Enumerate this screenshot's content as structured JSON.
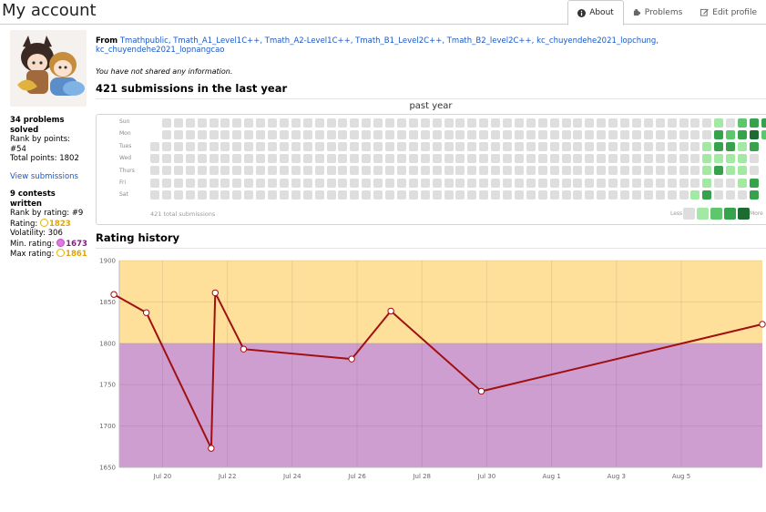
{
  "page": {
    "title": "My account"
  },
  "tabs": [
    {
      "label": "About",
      "icon": "info-icon",
      "active": true
    },
    {
      "label": "Problems",
      "icon": "puzzle-icon",
      "active": false
    },
    {
      "label": "Edit profile",
      "icon": "edit-icon",
      "active": false
    }
  ],
  "sidebar": {
    "problems_solved": "34 problems solved",
    "rank_by_points": "Rank by points: #54",
    "total_points": "Total points: 1802",
    "view_submissions": "View submissions",
    "contests_written": "9 contests written",
    "rank_by_rating": "Rank by rating: #9",
    "rating_label": "Rating:",
    "rating_value": "1823",
    "volatility": "Volatility: 306",
    "min_rating_label": "Min. rating:",
    "min_rating_value": "1673",
    "max_rating_label": "Max rating:",
    "max_rating_value": "1861",
    "colors": {
      "gold": "#e3a400",
      "purple": "#7c1f7c"
    }
  },
  "profile": {
    "from_label": "From",
    "organizations": "Tmathpublic, Tmath_A1_Level1C++, Tmath_A2-Level1C++, Tmath_B1_Level2C++, Tmath_B2_level2C++, kc_chuyendehe2021_lopchung, kc_chuyendehe2021_lopnangcao",
    "info_note": "You have not shared any information."
  },
  "submissions": {
    "heading": "421 submissions in the last year",
    "heatmap_title": "past year",
    "days": [
      "Sun",
      "Mon",
      "Tues",
      "Wed",
      "Thurs",
      "Fri",
      "Sat"
    ],
    "total_label": "421 total submissions",
    "less_label": "Less",
    "more_label": "More",
    "colors": [
      "#dedede",
      "#a3e8a3",
      "#5ec76e",
      "#37a24c",
      "#1d6b31"
    ],
    "recent_levels": [
      [
        0,
        0,
        0,
        0,
        0,
        0,
        0
      ],
      [
        0,
        0,
        0,
        0,
        0,
        0,
        1
      ],
      [
        0,
        0,
        1,
        1,
        1,
        1,
        3
      ],
      [
        1,
        3,
        3,
        1,
        3,
        0,
        0
      ],
      [
        0,
        2,
        3,
        1,
        1,
        0,
        0
      ],
      [
        2,
        3,
        1,
        1,
        1,
        1,
        0
      ],
      [
        3,
        4,
        3,
        0,
        0,
        3,
        3
      ],
      [
        3,
        2,
        0,
        0,
        0,
        0,
        0
      ]
    ]
  },
  "rating_history": {
    "heading": "Rating history"
  },
  "chart_data": {
    "type": "line",
    "title": "Rating history",
    "xlabel": "",
    "ylabel": "",
    "x_ticks": [
      "Jul 20",
      "Jul 22",
      "Jul 24",
      "Jul 26",
      "Jul 28",
      "Jul 30",
      "Aug 1",
      "Aug 3",
      "Aug 5"
    ],
    "ylim": [
      1650,
      1900
    ],
    "y_ticks": [
      1650,
      1700,
      1750,
      1800,
      1850,
      1900
    ],
    "x_range": [
      "2021-07-18T16:00",
      "2021-08-07T12:00"
    ],
    "series": [
      {
        "x": [
          "2021-07-18T12:00",
          "2021-07-19T12:00",
          "2021-07-21T12:00",
          "2021-07-21T15:00",
          "2021-07-22T12:00",
          "2021-07-25T20:00",
          "2021-07-27T01:00",
          "2021-07-29T20:00",
          "2021-08-07T12:00"
        ],
        "values": [
          1859,
          1837,
          1673,
          1861,
          1793,
          1781,
          1839,
          1742,
          1823
        ],
        "color": "#a01010"
      }
    ],
    "bands": [
      {
        "from": 1800,
        "to": 1900,
        "color": "#fee09a"
      },
      {
        "from": 1650,
        "to": 1800,
        "color": "#cf9ed0"
      }
    ],
    "grid": true
  }
}
